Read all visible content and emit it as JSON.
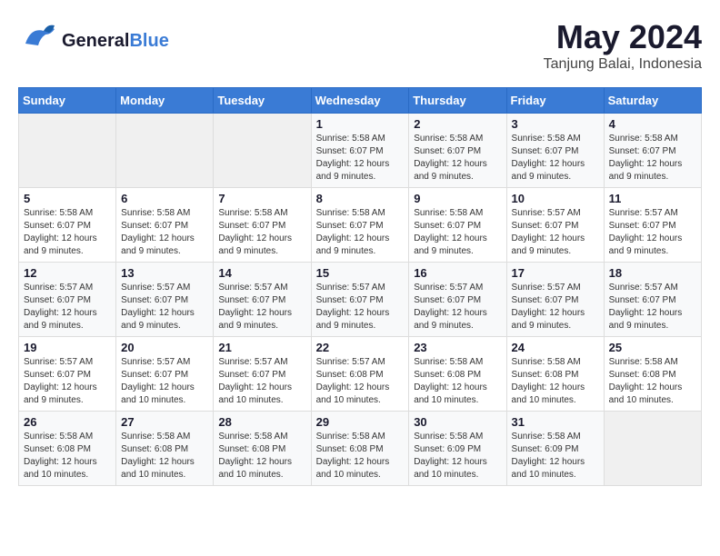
{
  "header": {
    "logo_general": "General",
    "logo_blue": "Blue",
    "title": "May 2024",
    "subtitle": "Tanjung Balai, Indonesia"
  },
  "calendar": {
    "weekdays": [
      "Sunday",
      "Monday",
      "Tuesday",
      "Wednesday",
      "Thursday",
      "Friday",
      "Saturday"
    ],
    "weeks": [
      [
        {
          "day": "",
          "info": ""
        },
        {
          "day": "",
          "info": ""
        },
        {
          "day": "",
          "info": ""
        },
        {
          "day": "1",
          "info": "Sunrise: 5:58 AM\nSunset: 6:07 PM\nDaylight: 12 hours and 9 minutes."
        },
        {
          "day": "2",
          "info": "Sunrise: 5:58 AM\nSunset: 6:07 PM\nDaylight: 12 hours and 9 minutes."
        },
        {
          "day": "3",
          "info": "Sunrise: 5:58 AM\nSunset: 6:07 PM\nDaylight: 12 hours and 9 minutes."
        },
        {
          "day": "4",
          "info": "Sunrise: 5:58 AM\nSunset: 6:07 PM\nDaylight: 12 hours and 9 minutes."
        }
      ],
      [
        {
          "day": "5",
          "info": "Sunrise: 5:58 AM\nSunset: 6:07 PM\nDaylight: 12 hours and 9 minutes."
        },
        {
          "day": "6",
          "info": "Sunrise: 5:58 AM\nSunset: 6:07 PM\nDaylight: 12 hours and 9 minutes."
        },
        {
          "day": "7",
          "info": "Sunrise: 5:58 AM\nSunset: 6:07 PM\nDaylight: 12 hours and 9 minutes."
        },
        {
          "day": "8",
          "info": "Sunrise: 5:58 AM\nSunset: 6:07 PM\nDaylight: 12 hours and 9 minutes."
        },
        {
          "day": "9",
          "info": "Sunrise: 5:58 AM\nSunset: 6:07 PM\nDaylight: 12 hours and 9 minutes."
        },
        {
          "day": "10",
          "info": "Sunrise: 5:57 AM\nSunset: 6:07 PM\nDaylight: 12 hours and 9 minutes."
        },
        {
          "day": "11",
          "info": "Sunrise: 5:57 AM\nSunset: 6:07 PM\nDaylight: 12 hours and 9 minutes."
        }
      ],
      [
        {
          "day": "12",
          "info": "Sunrise: 5:57 AM\nSunset: 6:07 PM\nDaylight: 12 hours and 9 minutes."
        },
        {
          "day": "13",
          "info": "Sunrise: 5:57 AM\nSunset: 6:07 PM\nDaylight: 12 hours and 9 minutes."
        },
        {
          "day": "14",
          "info": "Sunrise: 5:57 AM\nSunset: 6:07 PM\nDaylight: 12 hours and 9 minutes."
        },
        {
          "day": "15",
          "info": "Sunrise: 5:57 AM\nSunset: 6:07 PM\nDaylight: 12 hours and 9 minutes."
        },
        {
          "day": "16",
          "info": "Sunrise: 5:57 AM\nSunset: 6:07 PM\nDaylight: 12 hours and 9 minutes."
        },
        {
          "day": "17",
          "info": "Sunrise: 5:57 AM\nSunset: 6:07 PM\nDaylight: 12 hours and 9 minutes."
        },
        {
          "day": "18",
          "info": "Sunrise: 5:57 AM\nSunset: 6:07 PM\nDaylight: 12 hours and 9 minutes."
        }
      ],
      [
        {
          "day": "19",
          "info": "Sunrise: 5:57 AM\nSunset: 6:07 PM\nDaylight: 12 hours and 9 minutes."
        },
        {
          "day": "20",
          "info": "Sunrise: 5:57 AM\nSunset: 6:07 PM\nDaylight: 12 hours and 10 minutes."
        },
        {
          "day": "21",
          "info": "Sunrise: 5:57 AM\nSunset: 6:07 PM\nDaylight: 12 hours and 10 minutes."
        },
        {
          "day": "22",
          "info": "Sunrise: 5:57 AM\nSunset: 6:08 PM\nDaylight: 12 hours and 10 minutes."
        },
        {
          "day": "23",
          "info": "Sunrise: 5:58 AM\nSunset: 6:08 PM\nDaylight: 12 hours and 10 minutes."
        },
        {
          "day": "24",
          "info": "Sunrise: 5:58 AM\nSunset: 6:08 PM\nDaylight: 12 hours and 10 minutes."
        },
        {
          "day": "25",
          "info": "Sunrise: 5:58 AM\nSunset: 6:08 PM\nDaylight: 12 hours and 10 minutes."
        }
      ],
      [
        {
          "day": "26",
          "info": "Sunrise: 5:58 AM\nSunset: 6:08 PM\nDaylight: 12 hours and 10 minutes."
        },
        {
          "day": "27",
          "info": "Sunrise: 5:58 AM\nSunset: 6:08 PM\nDaylight: 12 hours and 10 minutes."
        },
        {
          "day": "28",
          "info": "Sunrise: 5:58 AM\nSunset: 6:08 PM\nDaylight: 12 hours and 10 minutes."
        },
        {
          "day": "29",
          "info": "Sunrise: 5:58 AM\nSunset: 6:08 PM\nDaylight: 12 hours and 10 minutes."
        },
        {
          "day": "30",
          "info": "Sunrise: 5:58 AM\nSunset: 6:09 PM\nDaylight: 12 hours and 10 minutes."
        },
        {
          "day": "31",
          "info": "Sunrise: 5:58 AM\nSunset: 6:09 PM\nDaylight: 12 hours and 10 minutes."
        },
        {
          "day": "",
          "info": ""
        }
      ]
    ]
  }
}
